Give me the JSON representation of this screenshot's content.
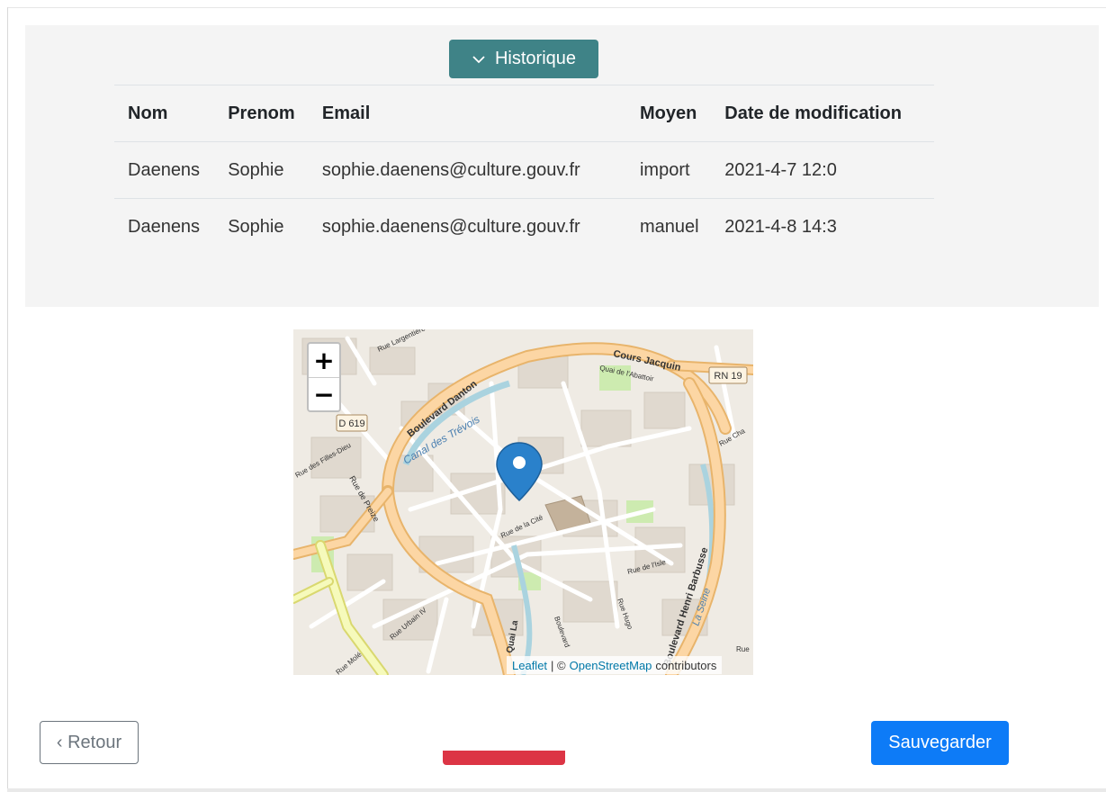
{
  "history": {
    "toggle_label": "Historique",
    "columns": [
      "Nom",
      "Prenom",
      "Email",
      "Moyen",
      "Date de modification"
    ],
    "rows": [
      [
        "Daenens",
        "Sophie",
        "sophie.daenens@culture.gouv.fr",
        "import",
        "2021-4-7 12:0"
      ],
      [
        "Daenens",
        "Sophie",
        "sophie.daenens@culture.gouv.fr",
        "manuel",
        "2021-4-8 14:3"
      ]
    ]
  },
  "map": {
    "zoom_in": "+",
    "zoom_out": "−",
    "attribution_leaflet": "Leaflet",
    "attribution_sep": "| ©",
    "attribution_osm": "OpenStreetMap",
    "attribution_tail": "contributors",
    "labels": {
      "rue_largentiere": "Rue Largentière",
      "cours_jacquin": "Cours Jacquin",
      "quai_abattoir": "Quai de l'Abattoir",
      "rn19": "RN 19",
      "boulevard_danton": "Boulevard Danton",
      "canal": "Canal des Trévois",
      "d619": "D 619",
      "rue_filles_dieu": "Rue des Filles-Dieu",
      "rue_preize": "Rue de Preize",
      "rue_cite": "Rue de la Cité",
      "rue_isle": "Rue de l'Isle",
      "boulevard_barbusse": "Boulevard Henri Barbusse",
      "seine": "La Seine",
      "rue_urbain": "Rue Urbain IV",
      "quai": "Quai La",
      "rue_mole": "Rue Molé",
      "rue_hugo": "Rue Hugo",
      "boulevard": "Boulevard",
      "rue_cha": "Rue Cha",
      "rue": "Rue"
    }
  },
  "actions": {
    "back_label": "‹ Retour",
    "save_label": "Sauvegarder"
  },
  "colors": {
    "toggle_bg": "#3f8387",
    "save_bg": "#0d7bf7",
    "delete_bg": "#dc3545",
    "marker": "#2a81cb"
  }
}
